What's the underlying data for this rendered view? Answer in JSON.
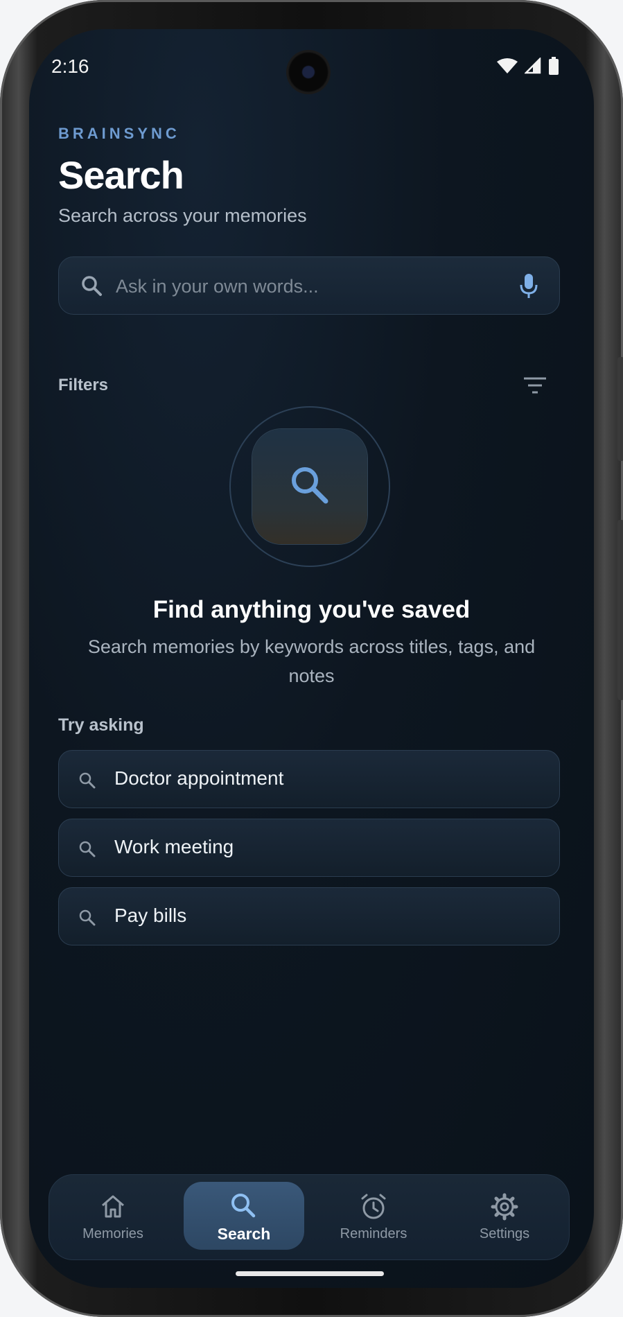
{
  "status_bar": {
    "time": "2:16"
  },
  "header": {
    "brand": "BRAINSYNC",
    "title": "Search",
    "subtitle": "Search across your memories"
  },
  "search": {
    "placeholder": "Ask in your own words..."
  },
  "filters": {
    "label": "Filters"
  },
  "empty_state": {
    "title": "Find anything you've saved",
    "description": "Search memories by keywords across titles, tags, and notes"
  },
  "try_asking": {
    "label": "Try asking",
    "suggestions": [
      "Doctor appointment",
      "Work meeting",
      "Pay bills"
    ]
  },
  "bottom_nav": {
    "items": [
      {
        "label": "Memories",
        "icon": "home-icon"
      },
      {
        "label": "Search",
        "icon": "search-icon",
        "active": true
      },
      {
        "label": "Reminders",
        "icon": "alarm-clock-icon"
      },
      {
        "label": "Settings",
        "icon": "gear-icon"
      }
    ]
  },
  "colors": {
    "background": "#0d1620",
    "accent": "#6e9bd0",
    "active_tab": "#3a5879"
  }
}
